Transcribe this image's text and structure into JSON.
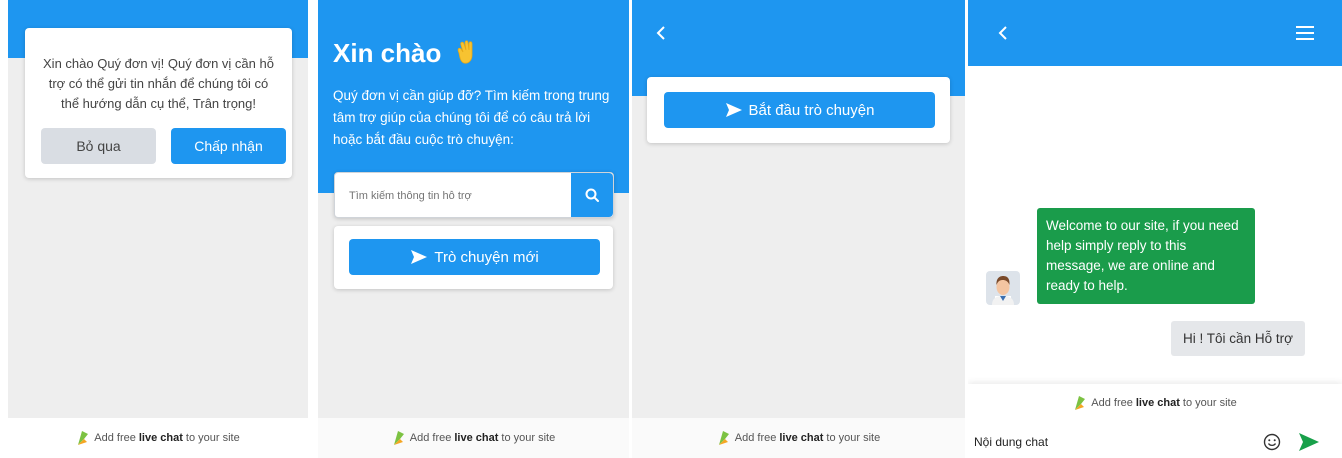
{
  "colors": {
    "accent": "#1e96f0",
    "bot_bubble": "#1a9c4b",
    "user_bubble": "#e5e7ea",
    "panel_bg": "#eeeeee"
  },
  "footer": {
    "prefix": "Add free",
    "bold": "live chat",
    "suffix": "to your site"
  },
  "consent": {
    "message": "Xin chào Quý đơn vị! Quý đơn vị cần hỗ trợ có thể gửi tin nhắn để chúng tôi có thể hướng dẫn cụ thể, Trân trọng!",
    "skip_label": "Bỏ qua",
    "accept_label": "Chấp nhận"
  },
  "welcome": {
    "title": "Xin chào",
    "wave_icon": "waving-hand-icon",
    "subtitle": "Quý đơn vị cần giúp đỡ? Tìm kiếm trong trung tâm trợ giúp của chúng tôi để có câu trả lời hoặc bắt đầu cuộc trò chuyện:",
    "search_placeholder": "Tìm kiếm thông tin hỗ trợ",
    "new_chat_label": "Trò chuyện mới"
  },
  "start": {
    "back_icon": "chevron-left-icon",
    "start_chat_label": "Bắt đầu trò chuyện"
  },
  "chat": {
    "back_icon": "chevron-left-icon",
    "menu_icon": "hamburger-menu-icon",
    "messages": [
      {
        "from": "bot",
        "text": "Welcome to our site, if you need help simply reply to this message, we are online and ready to help."
      },
      {
        "from": "user",
        "text": "Hi ! Tôi cần Hỗ trợ"
      }
    ],
    "input_value": "Nội dung chat",
    "emoji_icon": "smiley-icon",
    "send_icon": "send-arrow-icon"
  }
}
